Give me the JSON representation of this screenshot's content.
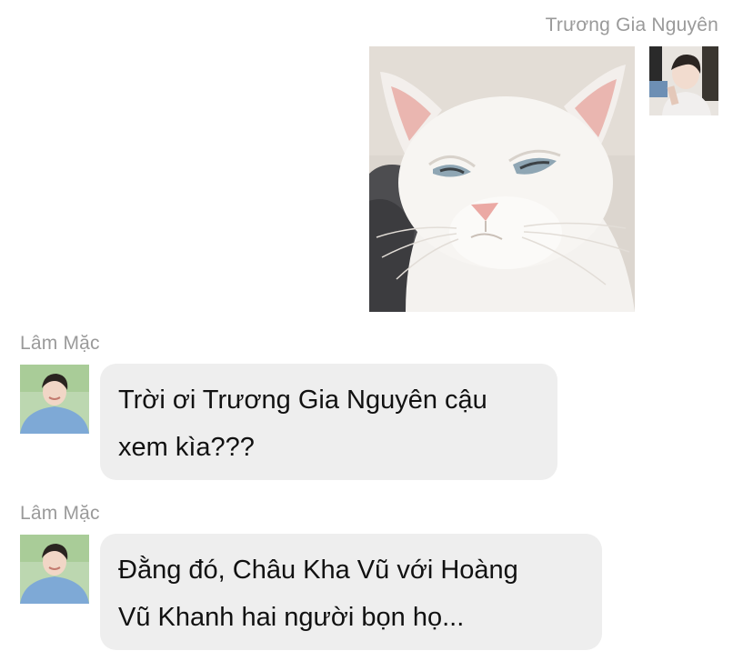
{
  "messages": [
    {
      "sender": "Trương Gia Nguyên",
      "side": "right",
      "type": "image",
      "image_subject": "white cat side-eye"
    },
    {
      "sender": "Lâm Mặc",
      "side": "left",
      "type": "text",
      "lines": [
        "Trời ơi Trương Gia Nguyên cậu",
        "xem kìa???"
      ]
    },
    {
      "sender": "Lâm Mặc",
      "side": "left",
      "type": "text",
      "lines": [
        "Đằng đó, Châu Kha Vũ với Hoàng",
        "Vũ Khanh hai người bọn họ..."
      ]
    }
  ],
  "colors": {
    "background": "#ffffff",
    "bubble": "#eeeeee",
    "sender_name": "#9a9a9a",
    "text": "#111111"
  }
}
